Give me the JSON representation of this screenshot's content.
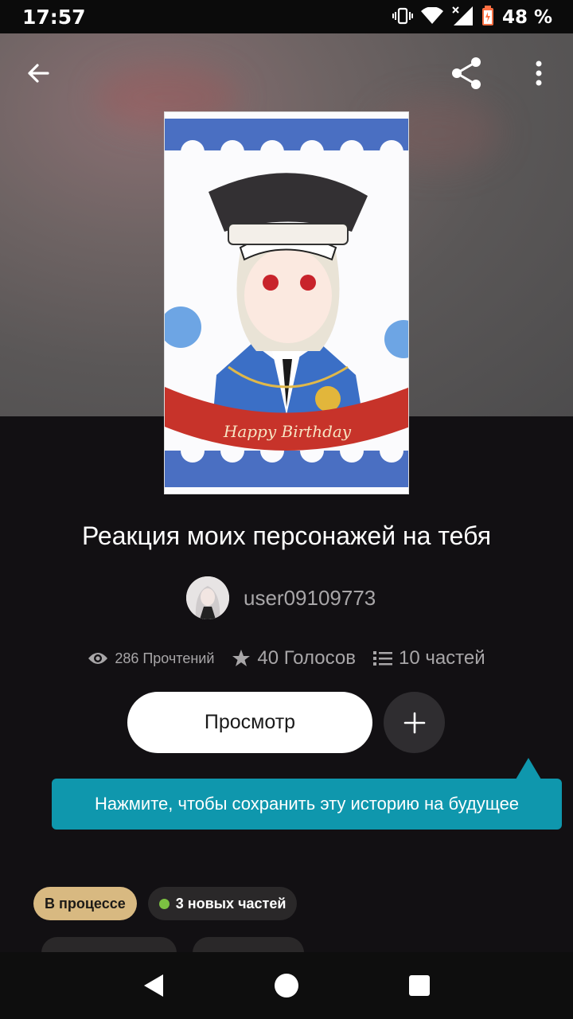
{
  "status_bar": {
    "time": "17:57",
    "battery_percent": "48 %",
    "icons": [
      "vibrate-icon",
      "wifi-icon",
      "signal-icon",
      "battery-icon"
    ]
  },
  "toolbar": {
    "back_icon": "arrow-left-icon",
    "share_icon": "share-icon",
    "more_icon": "more-vert-icon"
  },
  "cover": {
    "banner_text": "Happy Birthday"
  },
  "story": {
    "title": "Реакция моих персонажей на тебя",
    "author": "user09109773",
    "stats": {
      "reads": "286 Прочтений",
      "votes": "40 Голосов",
      "parts": "10 частей"
    }
  },
  "actions": {
    "read_label": "Просмотр",
    "add_icon": "plus-icon"
  },
  "tooltip": {
    "text": "Нажмите, чтобы сохранить эту историю на будущее"
  },
  "tags": {
    "status": "В процессе",
    "new_parts": "3 новых частей"
  },
  "colors": {
    "background": "#121013",
    "accent_tooltip": "#0f97ad",
    "status_tag": "#d8b981",
    "new_parts_dot": "#7cc142"
  }
}
